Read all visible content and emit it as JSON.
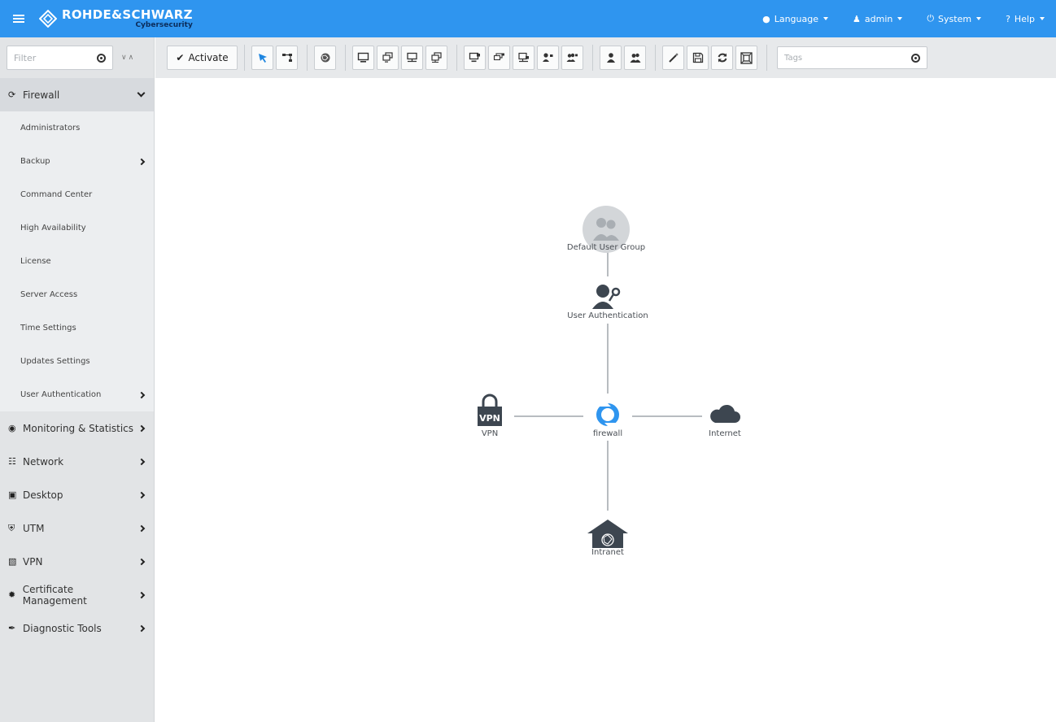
{
  "header": {
    "brand_name": "ROHDE&SCHWARZ",
    "brand_sub": "Cybersecurity",
    "menus": [
      {
        "label": "Language",
        "icon": "globe-icon"
      },
      {
        "label": "admin",
        "icon": "user-icon"
      },
      {
        "label": "System",
        "icon": "power-icon"
      },
      {
        "label": "Help",
        "icon": "question-icon"
      }
    ]
  },
  "sidebar": {
    "filter_placeholder": "Filter",
    "sections": [
      {
        "label": "Firewall",
        "icon": "firewall-icon",
        "open": true,
        "items": [
          {
            "label": "Administrators",
            "has_children": false
          },
          {
            "label": "Backup",
            "has_children": true
          },
          {
            "label": "Command Center",
            "has_children": false
          },
          {
            "label": "High Availability",
            "has_children": false
          },
          {
            "label": "License",
            "has_children": false
          },
          {
            "label": "Server Access",
            "has_children": false
          },
          {
            "label": "Time Settings",
            "has_children": false
          },
          {
            "label": "Updates Settings",
            "has_children": false
          },
          {
            "label": "User Authentication",
            "has_children": true
          }
        ]
      },
      {
        "label": "Monitoring & Statistics",
        "icon": "eye-icon"
      },
      {
        "label": "Network",
        "icon": "sitemap-icon"
      },
      {
        "label": "Desktop",
        "icon": "desktop-icon"
      },
      {
        "label": "UTM",
        "icon": "shield-icon"
      },
      {
        "label": "VPN",
        "icon": "lock-icon"
      },
      {
        "label": "Certificate Management",
        "icon": "certificate-icon"
      },
      {
        "label": "Diagnostic Tools",
        "icon": "wrench-icon"
      }
    ]
  },
  "toolbar": {
    "activate_label": "Activate",
    "tags_placeholder": "Tags"
  },
  "diagram": {
    "nodes": {
      "default_user_group": "Default User Group",
      "user_authentication": "User Authentication",
      "vpn": "VPN",
      "vpn_badge": "VPN",
      "firewall": "firewall",
      "internet": "Internet",
      "intranet": "Intranet"
    }
  },
  "colors": {
    "header_bg": "#2f95ef",
    "sidebar_bg": "#e2e4e6",
    "icon_dark": "#3d4650",
    "firewall_blue": "#2f95ef"
  }
}
